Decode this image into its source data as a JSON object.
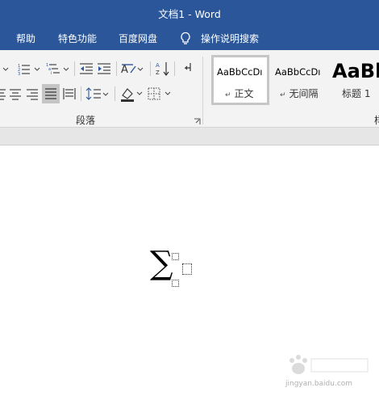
{
  "window": {
    "title": "文档1  -  Word"
  },
  "tabs": [
    {
      "label": "帮助"
    },
    {
      "label": "特色功能"
    },
    {
      "label": "百度网盘"
    },
    {
      "label": "操作说明搜索"
    }
  ],
  "ribbon": {
    "paragraph_group_label": "段落",
    "next_group_label_partial": "样",
    "styles": [
      {
        "sample": "AaBbCcDı",
        "name": "正文",
        "selected": true
      },
      {
        "sample": "AaBbCcDı",
        "name": "无间隔",
        "selected": false
      },
      {
        "sample": "AaBl",
        "name": "标题 1",
        "selected": false
      }
    ]
  },
  "document": {
    "equation_operator": "∑"
  },
  "watermark": {
    "text": "jingyan.baidu.com"
  },
  "colors": {
    "title_bar": "#2b579a",
    "ribbon_bg": "#f3f3f3",
    "page_bg": "#ffffff"
  }
}
